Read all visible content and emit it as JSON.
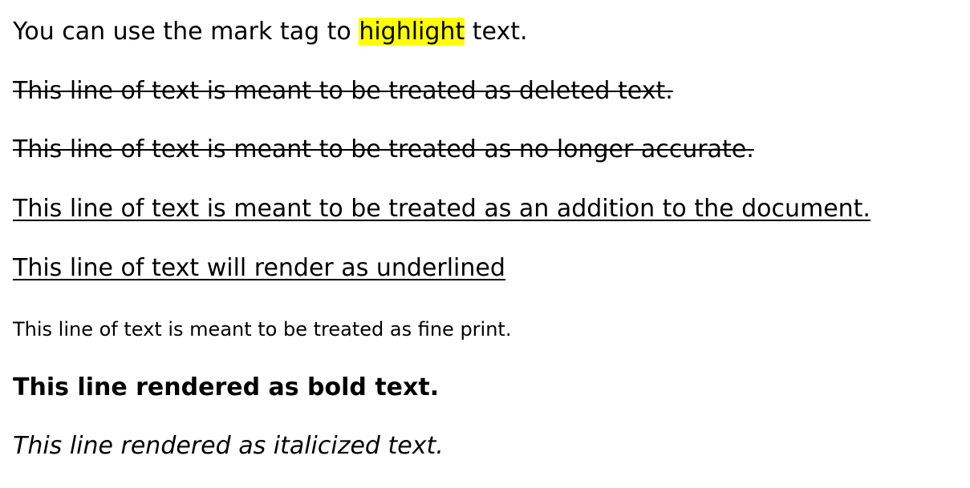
{
  "lines": {
    "mark_line": {
      "before": "You can use the mark tag to ",
      "highlight": "highlight",
      "after": " text."
    },
    "deleted": "This line of text is meant to be treated as deleted text.",
    "strikethrough": "This line of text is meant to be treated as no longer accurate.",
    "inserted": "This line of text is meant to be treated as an addition to the document.",
    "underlined": "This line of text will render as underlined",
    "fine_print": "This line of text is meant to be treated as fine print.",
    "bold": "This line rendered as bold text.",
    "italic": "This line rendered as italicized text."
  },
  "colors": {
    "highlight_background": "#ffff00",
    "text": "#000000",
    "page_background": "#ffffff"
  }
}
